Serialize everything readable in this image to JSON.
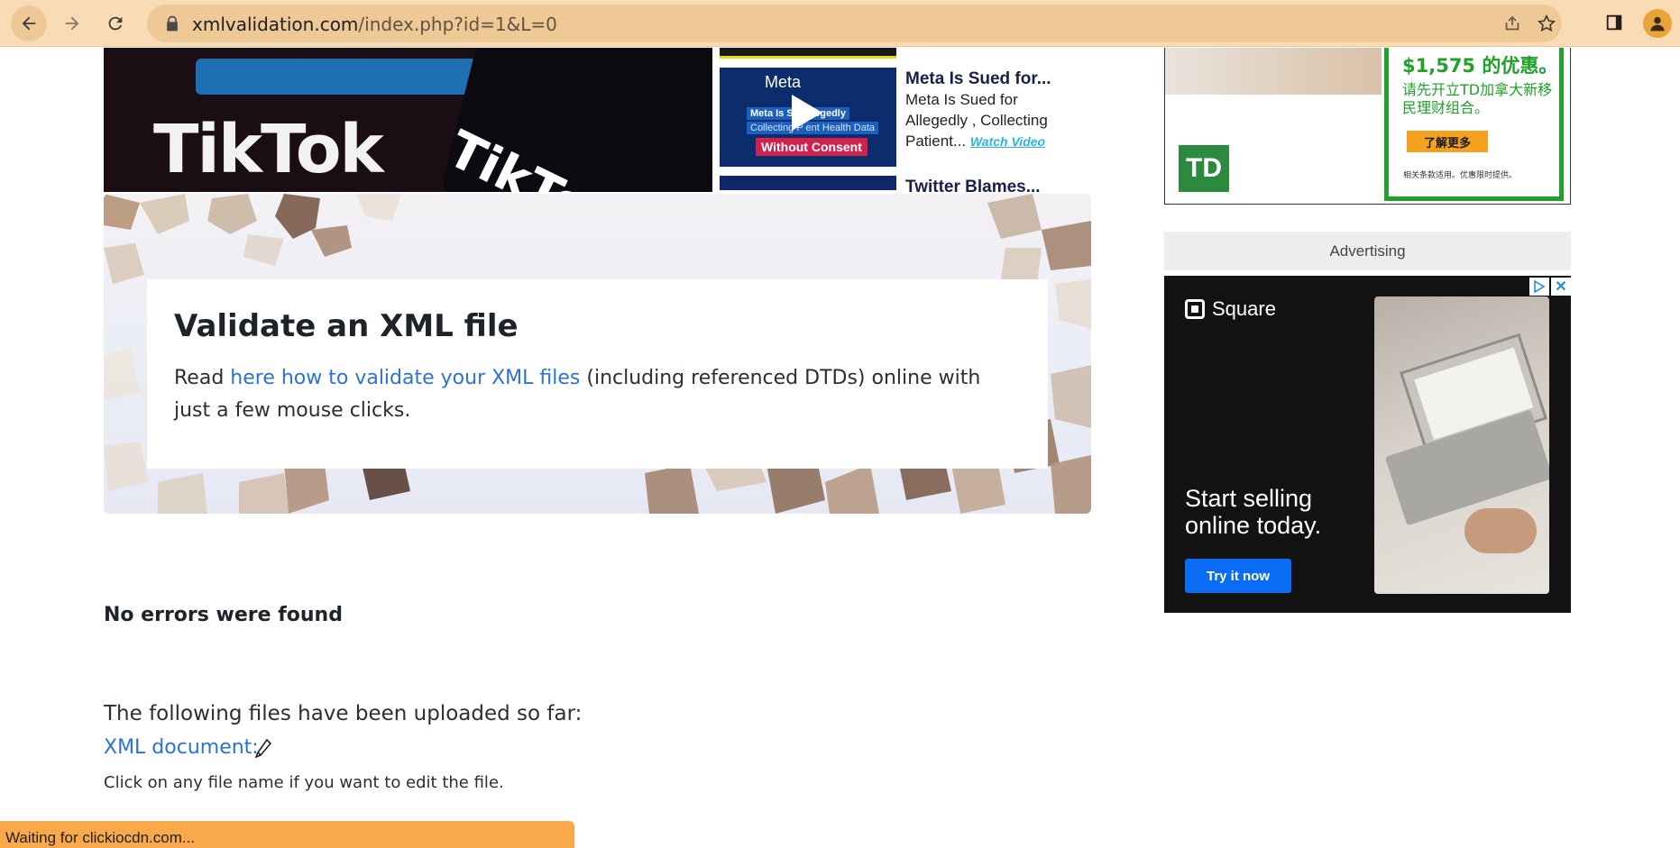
{
  "browser": {
    "url_host": "xmlvalidation.com",
    "url_path": "/index.php?id=1&L=0",
    "icons": [
      "back-arrow-icon",
      "forward-arrow-icon",
      "reload-icon",
      "lock-icon",
      "share-icon",
      "star-icon",
      "side-panel-icon",
      "profile-icon"
    ]
  },
  "tiktok_image": {
    "text_left": "TikTok",
    "text_right": "TikTok"
  },
  "videos": [
    {
      "thumb_label": "Meta",
      "thumb_caption_1": "Meta Is Su   Allegedly",
      "thumb_caption_2": "Collecting P   ent Health Data",
      "thumb_caption_3": "Without Consent",
      "title": "Meta Is Sued for...",
      "description": "Meta Is Sued for Allegedly , Collecting Patient...",
      "link": "Watch Video"
    },
    {
      "title": "Twitter Blames..."
    }
  ],
  "hero": {
    "title": "Validate an XML file",
    "text_before": "Read ",
    "link": "here how to validate your XML files",
    "text_after": " (including referenced DTDs) online with just a few mouse clicks."
  },
  "result": {
    "status": "No errors were found",
    "uploaded_label": "The following files have been uploaded so far:",
    "file_link": "XML document:",
    "hint": "Click on any file name if you want to edit the file."
  },
  "ads": {
    "td": {
      "price": "$1,575 的优惠。",
      "body": "请先开立TD加拿大新移民理财组合。",
      "cta": "了解更多",
      "fine": "相关条款适用。优惠限时提供。",
      "logo": "TD",
      "brand_color": "#1fa12a"
    },
    "label": "Advertising",
    "square": {
      "brand": "Square",
      "headline": "Start selling online today.",
      "cta": "Try it now",
      "close": "✕",
      "accent": "#0a6cf5"
    }
  },
  "status_bar": "Waiting for clickiocdn.com..."
}
